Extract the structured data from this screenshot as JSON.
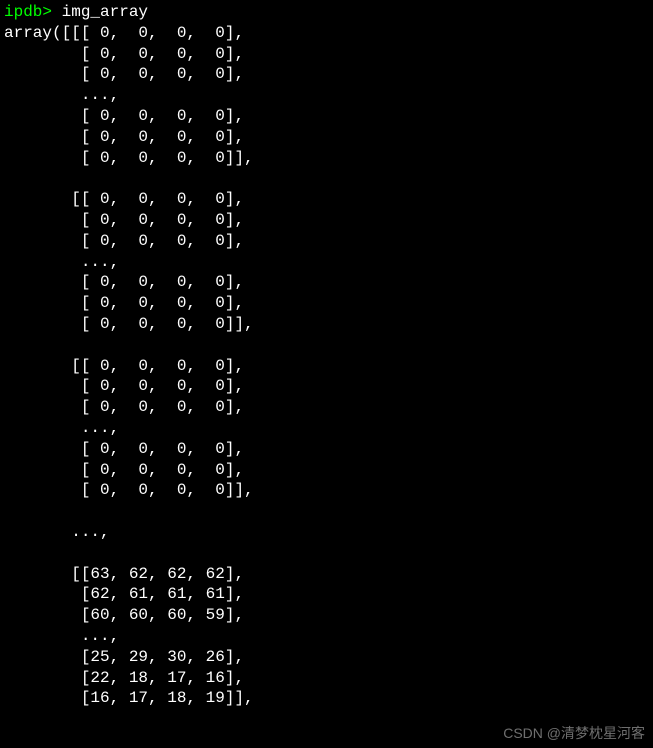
{
  "prompt": "ipdb> ",
  "command": "img_array",
  "output_lines": [
    "array([[[ 0,  0,  0,  0],",
    "        [ 0,  0,  0,  0],",
    "        [ 0,  0,  0,  0],",
    "        ...,",
    "        [ 0,  0,  0,  0],",
    "        [ 0,  0,  0,  0],",
    "        [ 0,  0,  0,  0]],",
    "",
    "       [[ 0,  0,  0,  0],",
    "        [ 0,  0,  0,  0],",
    "        [ 0,  0,  0,  0],",
    "        ...,",
    "        [ 0,  0,  0,  0],",
    "        [ 0,  0,  0,  0],",
    "        [ 0,  0,  0,  0]],",
    "",
    "       [[ 0,  0,  0,  0],",
    "        [ 0,  0,  0,  0],",
    "        [ 0,  0,  0,  0],",
    "        ...,",
    "        [ 0,  0,  0,  0],",
    "        [ 0,  0,  0,  0],",
    "        [ 0,  0,  0,  0]],",
    "",
    "       ...,",
    "",
    "       [[63, 62, 62, 62],",
    "        [62, 61, 61, 61],",
    "        [60, 60, 60, 59],",
    "        ...,",
    "        [25, 29, 30, 26],",
    "        [22, 18, 17, 16],",
    "        [16, 17, 18, 19]],"
  ],
  "watermark": "CSDN @清梦枕星河客"
}
